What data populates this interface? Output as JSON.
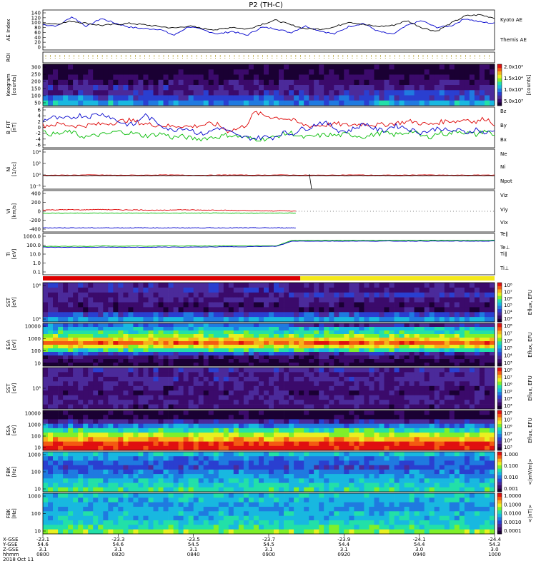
{
  "chart_data": {
    "type": "line",
    "title": "P2 (TH-C)",
    "time_ticks": [
      "0800",
      "0820",
      "0840",
      "0900",
      "0920",
      "0940",
      "1000"
    ],
    "ephemeris": {
      "x_label": "X-GSE",
      "y_label": "Y-GSE",
      "z_label": "Z-GSE",
      "t_label": "hhmm",
      "date": "2018 Oct 11",
      "x": [
        "-23.1",
        "-23.3",
        "-23.5",
        "-23.7",
        "-23.9",
        "-24.1",
        "-24.4"
      ],
      "y": [
        "54.6",
        "54.6",
        "54.5",
        "54.5",
        "54.4",
        "54.4",
        "54.3"
      ],
      "z": [
        "3.1",
        "3.1",
        "3.1",
        "3.1",
        "3.1",
        "3.0",
        "3.0"
      ]
    },
    "panels": [
      {
        "id": "ae",
        "label": "AE Index",
        "units": "",
        "yticks": [
          "140",
          "120",
          "100",
          "80",
          "60",
          "40",
          "20",
          "0"
        ],
        "ylim": [
          0,
          150
        ],
        "series": [
          {
            "name": "Kyoto AE",
            "color": "#0000cc",
            "values": [
              95,
              90,
              125,
              88,
              118,
              100,
              85,
              80,
              78,
              55,
              88,
              75,
              60,
              70,
              55,
              85,
              80,
              65,
              90,
              72,
              60,
              88,
              100,
              70,
              58,
              92,
              110,
              85,
              90,
              118,
              105,
              100
            ]
          },
          {
            "name": "Themis AE",
            "color": "#000000",
            "values": [
              100,
              98,
              108,
              100,
              92,
              96,
              100,
              94,
              88,
              82,
              90,
              80,
              76,
              86,
              78,
              96,
              112,
              94,
              80,
              78,
              86,
              106,
              95,
              88,
              92,
              110,
              84,
              70,
              100,
              128,
              132,
              120
            ]
          }
        ]
      },
      {
        "id": "roi",
        "label": "ROI"
      },
      {
        "id": "keogram",
        "label": "Keogram",
        "units": "[counts]",
        "yticks": [
          "300",
          "250",
          "200",
          "150",
          "100",
          "50"
        ],
        "colorbar": [
          "2.0x10⁴",
          "1.5x10⁴",
          "1.0x10⁴",
          "5.0x10³"
        ]
      },
      {
        "id": "bfield",
        "label": "B_FIT",
        "units": "[nT]",
        "yticks": [
          "6",
          "4",
          "2",
          "0",
          "-2",
          "-4",
          "-6"
        ],
        "ylim": [
          -6,
          6
        ],
        "series": [
          {
            "name": "Bz",
            "color": "#dd0000",
            "values": [
              0.5,
              0.8,
              1.0,
              0.6,
              0.4,
              0.7,
              0.9,
              1.2,
              1.5,
              2.2,
              1.8,
              1.0,
              0.8,
              0.6,
              0.3,
              0.5,
              0.2,
              0.6,
              1.0,
              0.8,
              -1.0,
              -0.5,
              0.6,
              4.5,
              3.5,
              3.0,
              2.8,
              2.2,
              1.0,
              0.4,
              0.6,
              0.8,
              1.0,
              0.6,
              0.9,
              1.1,
              0.7,
              0.8,
              1.2,
              1.5,
              1.8,
              1.2,
              0.8,
              1.5,
              2.0,
              1.8,
              2.5,
              1.5,
              2.8,
              1.0
            ]
          },
          {
            "name": "By",
            "color": "#00bb00",
            "values": [
              -1.5,
              -2.0,
              -1.8,
              -1.2,
              -2.5,
              -2.8,
              -2.2,
              -2.0,
              -1.2,
              -1.5,
              -1.8,
              -2.5,
              -2.2,
              -1.8,
              -3.0,
              -2.6,
              -3.2,
              -3.4,
              -3.0,
              -2.8,
              -2.2,
              -2.6,
              -3.0,
              -3.5,
              -3.4,
              -3.0,
              -2.0,
              -1.6,
              -3.0,
              -2.8,
              -2.4,
              -2.2,
              -2.4,
              -2.0,
              -2.4,
              -2.8,
              -2.0,
              -1.6,
              -2.2,
              -1.8,
              -1.0,
              -2.5,
              -2.8,
              -1.6,
              -2.0,
              -1.0,
              -1.6,
              -2.2,
              -0.8,
              -2.6
            ]
          },
          {
            "name": "Bx",
            "color": "#0000cc",
            "values": [
              2.0,
              3.0,
              2.4,
              2.8,
              3.6,
              3.2,
              4.0,
              3.6,
              2.0,
              1.0,
              0.8,
              3.8,
              2.0,
              0.5,
              -1.0,
              0.0,
              -0.5,
              -2.0,
              -1.5,
              0.0,
              -0.8,
              -2.5,
              -3.0,
              -3.2,
              -2.8,
              -3.0,
              -1.5,
              -2.0,
              -0.5,
              0.0,
              1.5,
              1.0,
              -0.8,
              -1.2,
              0.0,
              1.2,
              -0.5,
              -1.0,
              0.5,
              0.2,
              -0.8,
              -1.5,
              -1.0,
              0.0,
              -1.2,
              -0.8,
              -1.6,
              -0.5,
              -1.8,
              -1.0
            ]
          }
        ]
      },
      {
        "id": "density",
        "label": "Ni",
        "units": "[1/cc]",
        "yticks": [
          "10⁴",
          "10²",
          "10⁰",
          "10⁻²"
        ],
        "ylim": [
          -3,
          5
        ],
        "series": [
          {
            "name": "Ne",
            "color": "#dd0000",
            "values": [
              -0.2,
              -0.2,
              -0.15,
              -0.2,
              -0.2,
              -0.15,
              -0.2,
              -0.2,
              -0.15,
              -0.2,
              -0.15,
              -0.2,
              -0.2,
              -0.15,
              -0.2,
              -0.2,
              -0.15,
              -0.2,
              -0.2,
              -0.15
            ]
          },
          {
            "name": "Ni",
            "color": "#000000",
            "values": [
              -0.3,
              -0.3,
              -0.3,
              -0.3,
              -0.3,
              -0.3,
              -0.3,
              -0.3,
              -0.3,
              -0.3,
              -0.3,
              -0.3,
              -0.3,
              -0.3,
              -0.3,
              -0.3,
              -0.3,
              -0.3,
              -0.3,
              -0.3
            ]
          },
          {
            "name": "Npot",
            "color": "#0000cc",
            "values": []
          }
        ]
      },
      {
        "id": "velocity",
        "label": "Vi",
        "units": "[km/s]",
        "yticks": [
          "400",
          "200",
          "0",
          "-200",
          "-400"
        ],
        "ylim": [
          -500,
          400
        ],
        "series": [
          {
            "name": "Viz",
            "color": "#dd0000",
            "values": [
              -20,
              -18,
              -15,
              -20,
              -10,
              -15,
              -20,
              -18,
              -25,
              -30,
              -15,
              -20,
              -25,
              -22,
              -30,
              -35,
              -40,
              -45,
              -38,
              -50
            ]
          },
          {
            "name": "Viy",
            "color": "#00bb00",
            "values": [
              -90,
              -90,
              -90,
              -90,
              -90,
              -90,
              -90,
              -90,
              -90,
              -90,
              -90,
              -90,
              -90,
              -90,
              -90,
              -90,
              -90,
              -90,
              -90,
              -90
            ]
          },
          {
            "name": "Vix",
            "color": "#0000cc",
            "values": [
              -410,
              -410,
              -410,
              -410,
              -410,
              -410,
              -410,
              -410,
              -410,
              -410,
              -410,
              -410,
              -410,
              -410,
              -410,
              -410,
              -410,
              -410,
              -410,
              -410
            ]
          }
        ]
      },
      {
        "id": "temp",
        "label": "Ti",
        "units": "[eV]",
        "yticks": [
          "1000.0",
          "100.0",
          "10.0",
          "1.0",
          "0.1"
        ],
        "ylim": [
          -1.3,
          3.5
        ],
        "series": [
          {
            "name": "Te∥",
            "color": "#000000",
            "values": []
          },
          {
            "name": "Te⊥",
            "color": "#dd0000",
            "values": []
          },
          {
            "name": "Ti∥",
            "color": "#00bb00",
            "values": [
              2.0,
              2.0,
              2.02,
              2.0,
              2.05,
              2.0,
              2.04,
              2.02,
              2.06,
              2.03,
              2.05,
              2.04,
              2.06,
              2.05,
              2.06,
              2.06,
              2.7,
              2.7,
              2.7,
              2.7,
              2.7,
              2.7,
              2.7,
              2.7,
              2.7,
              2.7,
              2.7,
              2.7,
              2.7,
              2.7
            ]
          },
          {
            "name": "Ti⊥",
            "color": "#0000cc",
            "values": [
              1.9,
              1.88,
              1.9,
              1.89,
              1.9,
              1.88,
              1.9,
              1.9,
              1.92,
              1.9,
              1.92,
              1.93,
              1.95,
              1.96,
              1.98,
              2.0,
              2.6,
              2.6,
              2.6,
              2.6,
              2.6,
              2.6,
              2.6,
              2.6,
              2.6,
              2.6,
              2.6,
              2.6,
              2.6,
              2.6
            ]
          }
        ]
      },
      {
        "id": "mode",
        "label": ""
      },
      {
        "id": "sst_i",
        "label": "SST",
        "units": "[eV]",
        "yticks": [
          "10⁶",
          "10⁵"
        ],
        "colorbar_label": "Eflux, EFU"
      },
      {
        "id": "esa_i",
        "label": "ESA",
        "units": "[eV]",
        "yticks": [
          "10000",
          "1000",
          "100",
          "10"
        ],
        "colorbar_label": "Eflux, EFU"
      },
      {
        "id": "sst_e",
        "label": "SST",
        "units": "[eV]",
        "yticks": [
          "10⁵"
        ],
        "colorbar_label": "Eflux, EFU"
      },
      {
        "id": "esa_e",
        "label": "ESA",
        "units": "[eV]",
        "yticks": [
          "10000",
          "1000",
          "100",
          "10"
        ],
        "colorbar_label": "Eflux, EFU"
      },
      {
        "id": "fbk_e",
        "label": "FBK",
        "units": "[Hz]",
        "yticks": [
          "1000",
          "100",
          "10"
        ],
        "colorbar_label": "<|mV/m|>",
        "colorbar": [
          "1.000",
          "0.100",
          "0.010",
          "0.001"
        ]
      },
      {
        "id": "fbk_b",
        "label": "FBK",
        "units": "[Hz]",
        "yticks": [
          "1000",
          "100",
          "10"
        ],
        "colorbar_label": "<|nT|>",
        "colorbar": [
          "1.0000",
          "0.1000",
          "0.0100",
          "0.0010",
          "0.0001"
        ]
      }
    ],
    "eflux_ticks": [
      "10⁸",
      "10⁷",
      "10⁶",
      "10⁵",
      "10⁴",
      "10³"
    ]
  }
}
